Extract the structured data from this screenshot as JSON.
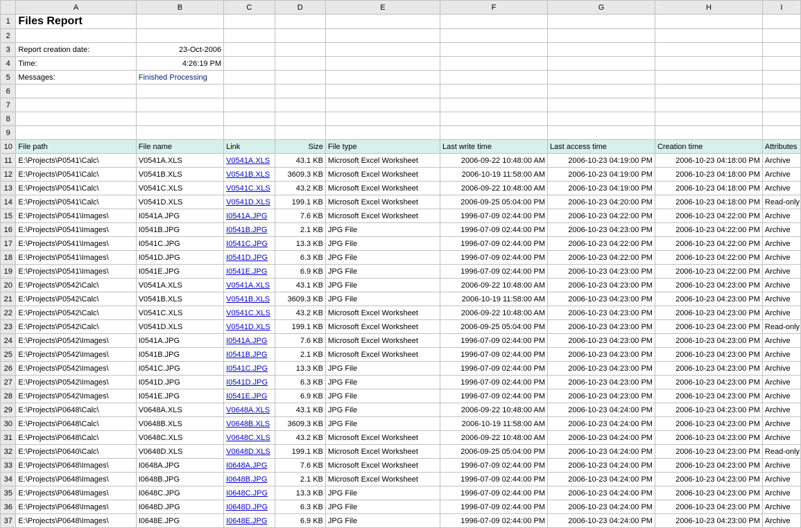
{
  "colLetters": [
    "A",
    "B",
    "C",
    "D",
    "E",
    "F",
    "G",
    "H",
    "I"
  ],
  "meta": {
    "title": "Files Report",
    "reportDateLabel": "Report creation date:",
    "reportDate": "23-Oct-2006",
    "timeLabel": "Time:",
    "time": "4:26:19 PM",
    "messagesLabel": "Messages:",
    "messages": "Finished Processing"
  },
  "headers": {
    "A": "File path",
    "B": "File name",
    "C": "Link",
    "D": "Size",
    "E": "File type",
    "F": "Last write time",
    "G": "Last access time",
    "H": "Creation time",
    "I": "Attributes"
  },
  "chart_data": {
    "type": "table",
    "columns": [
      "File path",
      "File name",
      "Link",
      "Size",
      "File type",
      "Last write time",
      "Last access time",
      "Creation time",
      "Attributes"
    ],
    "rows": [
      {
        "path": "E:\\Projects\\P0541\\Calc\\",
        "name": "V0541A.XLS",
        "link": "V0541A.XLS",
        "size": "43.1 KB",
        "type": "Microsoft Excel Worksheet",
        "lw": "2006-09-22 10:48:00 AM",
        "la": "2006-10-23 04:19:00 PM",
        "cr": "2006-10-23 04:18:00 PM",
        "attr": "Archive"
      },
      {
        "path": "E:\\Projects\\P0541\\Calc\\",
        "name": "V0541B.XLS",
        "link": "V0541B.XLS",
        "size": "3609.3 KB",
        "type": "Microsoft Excel Worksheet",
        "lw": "2006-10-19 11:58:00 AM",
        "la": "2006-10-23 04:19:00 PM",
        "cr": "2006-10-23 04:18:00 PM",
        "attr": "Archive"
      },
      {
        "path": "E:\\Projects\\P0541\\Calc\\",
        "name": "V0541C.XLS",
        "link": "V0541C.XLS",
        "size": "43.2 KB",
        "type": "Microsoft Excel Worksheet",
        "lw": "2006-09-22 10:48:00 AM",
        "la": "2006-10-23 04:19:00 PM",
        "cr": "2006-10-23 04:18:00 PM",
        "attr": "Archive"
      },
      {
        "path": "E:\\Projects\\P0541\\Calc\\",
        "name": "V0541D.XLS",
        "link": "V0541D.XLS",
        "size": "199.1 KB",
        "type": "Microsoft Excel Worksheet",
        "lw": "2006-09-25 05:04:00 PM",
        "la": "2006-10-23 04:20:00 PM",
        "cr": "2006-10-23 04:18:00 PM",
        "attr": "Read-only"
      },
      {
        "path": "E:\\Projects\\P0541\\Images\\",
        "name": "I0541A.JPG",
        "link": "I0541A.JPG",
        "size": "7.6 KB",
        "type": "Microsoft Excel Worksheet",
        "lw": "1996-07-09 02:44:00 PM",
        "la": "2006-10-23 04:22:00 PM",
        "cr": "2006-10-23 04:22:00 PM",
        "attr": "Archive"
      },
      {
        "path": "E:\\Projects\\P0541\\Images\\",
        "name": "I0541B.JPG",
        "link": "I0541B.JPG",
        "size": "2.1 KB",
        "type": "JPG File",
        "lw": "1996-07-09 02:44:00 PM",
        "la": "2006-10-23 04:23:00 PM",
        "cr": "2006-10-23 04:22:00 PM",
        "attr": "Archive"
      },
      {
        "path": "E:\\Projects\\P0541\\Images\\",
        "name": "I0541C.JPG",
        "link": "I0541C.JPG",
        "size": "13.3 KB",
        "type": "JPG File",
        "lw": "1996-07-09 02:44:00 PM",
        "la": "2006-10-23 04:22:00 PM",
        "cr": "2006-10-23 04:22:00 PM",
        "attr": "Archive"
      },
      {
        "path": "E:\\Projects\\P0541\\Images\\",
        "name": "I0541D.JPG",
        "link": "I0541D.JPG",
        "size": "6.3 KB",
        "type": "JPG File",
        "lw": "1996-07-09 02:44:00 PM",
        "la": "2006-10-23 04:22:00 PM",
        "cr": "2006-10-23 04:22:00 PM",
        "attr": "Archive"
      },
      {
        "path": "E:\\Projects\\P0541\\Images\\",
        "name": "I0541E.JPG",
        "link": "I0541E.JPG",
        "size": "6.9 KB",
        "type": "JPG File",
        "lw": "1996-07-09 02:44:00 PM",
        "la": "2006-10-23 04:23:00 PM",
        "cr": "2006-10-23 04:22:00 PM",
        "attr": "Archive"
      },
      {
        "path": "E:\\Projects\\P0542\\Calc\\",
        "name": "V0541A.XLS",
        "link": "V0541A.XLS",
        "size": "43.1 KB",
        "type": "JPG File",
        "lw": "2006-09-22 10:48:00 AM",
        "la": "2006-10-23 04:23:00 PM",
        "cr": "2006-10-23 04:23:00 PM",
        "attr": "Archive"
      },
      {
        "path": "E:\\Projects\\P0542\\Calc\\",
        "name": "V0541B.XLS",
        "link": "V0541B.XLS",
        "size": "3609.3 KB",
        "type": "JPG File",
        "lw": "2006-10-19 11:58:00 AM",
        "la": "2006-10-23 04:23:00 PM",
        "cr": "2006-10-23 04:23:00 PM",
        "attr": "Archive"
      },
      {
        "path": "E:\\Projects\\P0542\\Calc\\",
        "name": "V0541C.XLS",
        "link": "V0541C.XLS",
        "size": "43.2 KB",
        "type": "Microsoft Excel Worksheet",
        "lw": "2006-09-22 10:48:00 AM",
        "la": "2006-10-23 04:23:00 PM",
        "cr": "2006-10-23 04:23:00 PM",
        "attr": "Archive"
      },
      {
        "path": "E:\\Projects\\P0542\\Calc\\",
        "name": "V0541D.XLS",
        "link": "V0541D.XLS",
        "size": "199.1 KB",
        "type": "Microsoft Excel Worksheet",
        "lw": "2006-09-25 05:04:00 PM",
        "la": "2006-10-23 04:23:00 PM",
        "cr": "2006-10-23 04:23:00 PM",
        "attr": "Read-only"
      },
      {
        "path": "E:\\Projects\\P0542\\Images\\",
        "name": "I0541A.JPG",
        "link": "I0541A.JPG",
        "size": "7.6 KB",
        "type": "Microsoft Excel Worksheet",
        "lw": "1996-07-09 02:44:00 PM",
        "la": "2006-10-23 04:23:00 PM",
        "cr": "2006-10-23 04:23:00 PM",
        "attr": "Archive"
      },
      {
        "path": "E:\\Projects\\P0542\\Images\\",
        "name": "I0541B.JPG",
        "link": "I0541B.JPG",
        "size": "2.1 KB",
        "type": "Microsoft Excel Worksheet",
        "lw": "1996-07-09 02:44:00 PM",
        "la": "2006-10-23 04:23:00 PM",
        "cr": "2006-10-23 04:23:00 PM",
        "attr": "Archive"
      },
      {
        "path": "E:\\Projects\\P0542\\Images\\",
        "name": "I0541C.JPG",
        "link": "I0541C.JPG",
        "size": "13.3 KB",
        "type": "JPG File",
        "lw": "1996-07-09 02:44:00 PM",
        "la": "2006-10-23 04:23:00 PM",
        "cr": "2006-10-23 04:23:00 PM",
        "attr": "Archive"
      },
      {
        "path": "E:\\Projects\\P0542\\Images\\",
        "name": "I0541D.JPG",
        "link": "I0541D.JPG",
        "size": "6.3 KB",
        "type": "JPG File",
        "lw": "1996-07-09 02:44:00 PM",
        "la": "2006-10-23 04:23:00 PM",
        "cr": "2006-10-23 04:23:00 PM",
        "attr": "Archive"
      },
      {
        "path": "E:\\Projects\\P0542\\Images\\",
        "name": "I0541E.JPG",
        "link": "I0541E.JPG",
        "size": "6.9 KB",
        "type": "JPG File",
        "lw": "1996-07-09 02:44:00 PM",
        "la": "2006-10-23 04:23:00 PM",
        "cr": "2006-10-23 04:23:00 PM",
        "attr": "Archive"
      },
      {
        "path": "E:\\Projects\\P0648\\Calc\\",
        "name": "V0648A.XLS",
        "link": "V0648A.XLS",
        "size": "43.1 KB",
        "type": "JPG File",
        "lw": "2006-09-22 10:48:00 AM",
        "la": "2006-10-23 04:24:00 PM",
        "cr": "2006-10-23 04:23:00 PM",
        "attr": "Archive"
      },
      {
        "path": "E:\\Projects\\P0648\\Calc\\",
        "name": "V0648B.XLS",
        "link": "V0648B.XLS",
        "size": "3609.3 KB",
        "type": "JPG File",
        "lw": "2006-10-19 11:58:00 AM",
        "la": "2006-10-23 04:24:00 PM",
        "cr": "2006-10-23 04:23:00 PM",
        "attr": "Archive"
      },
      {
        "path": "E:\\Projects\\P0648\\Calc\\",
        "name": "V0648C.XLS",
        "link": "V0648C.XLS",
        "size": "43.2 KB",
        "type": "Microsoft Excel Worksheet",
        "lw": "2006-09-22 10:48:00 AM",
        "la": "2006-10-23 04:24:00 PM",
        "cr": "2006-10-23 04:23:00 PM",
        "attr": "Archive"
      },
      {
        "path": "E:\\Projects\\P0640\\Calc\\",
        "name": "V0648D.XLS",
        "link": "V0648D.XLS",
        "size": "199.1 KB",
        "type": "Microsoft Excel Worksheet",
        "lw": "2006-09-25 05:04:00 PM",
        "la": "2006-10-23 04:24:00 PM",
        "cr": "2006-10-23 04:23:00 PM",
        "attr": "Read-only"
      },
      {
        "path": "E:\\Projects\\P0648\\Images\\",
        "name": "I0648A.JPG",
        "link": "I0648A.JPG",
        "size": "7.6 KB",
        "type": "Microsoft Excel Worksheet",
        "lw": "1996-07-09 02:44:00 PM",
        "la": "2006-10-23 04:24:00 PM",
        "cr": "2006-10-23 04:23:00 PM",
        "attr": "Archive"
      },
      {
        "path": "E:\\Projects\\P0648\\Images\\",
        "name": "I0648B.JPG",
        "link": "I0648B.JPG",
        "size": "2.1 KB",
        "type": "Microsoft Excel Worksheet",
        "lw": "1996-07-09 02:44:00 PM",
        "la": "2006-10-23 04:24:00 PM",
        "cr": "2006-10-23 04:23:00 PM",
        "attr": "Archive"
      },
      {
        "path": "E:\\Projects\\P0648\\Images\\",
        "name": "I0648C.JPG",
        "link": "I0648C.JPG",
        "size": "13.3 KB",
        "type": "JPG File",
        "lw": "1996-07-09 02:44:00 PM",
        "la": "2006-10-23 04:24:00 PM",
        "cr": "2006-10-23 04:23:00 PM",
        "attr": "Archive"
      },
      {
        "path": "E:\\Projects\\P0648\\Images\\",
        "name": "I0648D.JPG",
        "link": "I0648D.JPG",
        "size": "6.3 KB",
        "type": "JPG File",
        "lw": "1996-07-09 02:44:00 PM",
        "la": "2006-10-23 04:24:00 PM",
        "cr": "2006-10-23 04:23:00 PM",
        "attr": "Archive"
      },
      {
        "path": "E:\\Projects\\P0648\\Images\\",
        "name": "I0648E.JPG",
        "link": "I0648E.JPG",
        "size": "6.9 KB",
        "type": "JPG File",
        "lw": "1996-07-09 02:44:00 PM",
        "la": "2006-10-23 04:24:00 PM",
        "cr": "2006-10-23 04:23:00 PM",
        "attr": "Archive"
      }
    ]
  }
}
